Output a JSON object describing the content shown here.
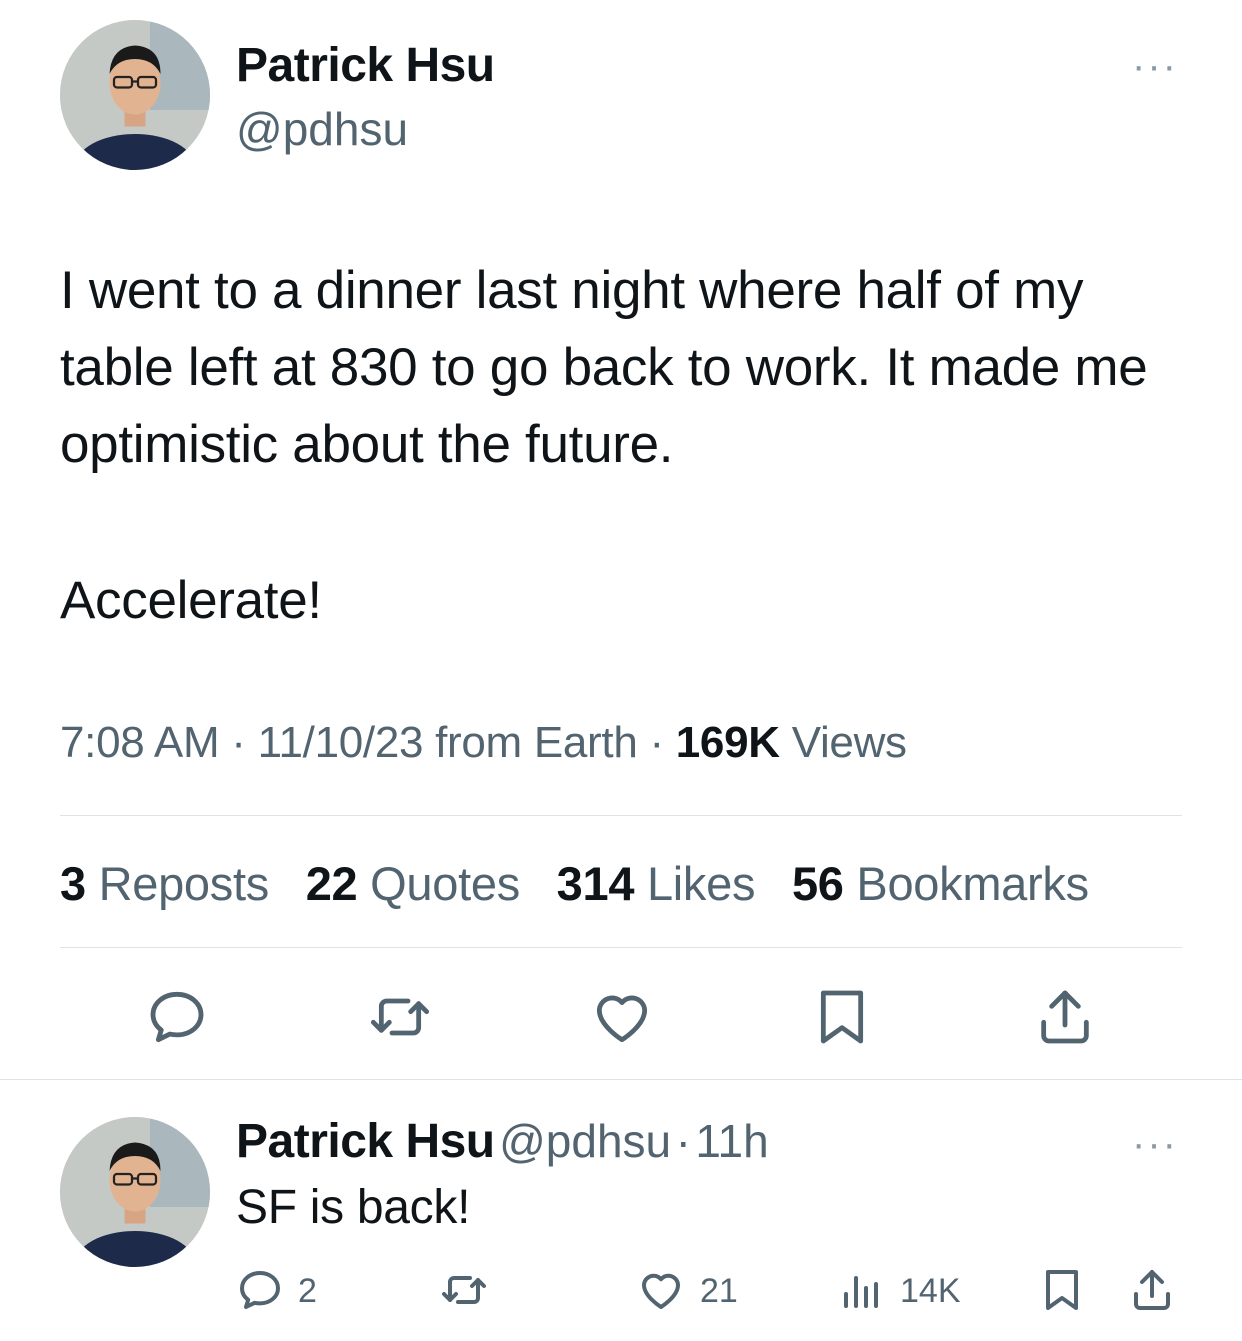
{
  "main_tweet": {
    "author_name": "Patrick Hsu",
    "author_handle": "@pdhsu",
    "more_label": "···",
    "text_paragraph_1": "I went to a dinner last night where half of my table left at 830 to go back to work. It made me optimistic about the future.",
    "text_paragraph_2": "Accelerate!",
    "time": "7:08 AM",
    "separator": "·",
    "date_source": "11/10/23 from Earth",
    "views_count": "169K",
    "views_label": "Views",
    "stats": {
      "reposts_count": "3",
      "reposts_label": "Reposts",
      "quotes_count": "22",
      "quotes_label": "Quotes",
      "likes_count": "314",
      "likes_label": "Likes",
      "bookmarks_count": "56",
      "bookmarks_label": "Bookmarks"
    },
    "actions": [
      "reply-icon",
      "repost-icon",
      "like-icon",
      "bookmark-icon",
      "share-icon"
    ]
  },
  "reply_tweet": {
    "author_name": "Patrick Hsu",
    "author_handle": "@pdhsu",
    "separator": "·",
    "time_ago": "11h",
    "more_label": "···",
    "text": "SF is back!",
    "reply_count": "2",
    "like_count": "21",
    "views_count": "14K"
  },
  "colors": {
    "text_primary": "#0f1419",
    "text_secondary": "#536471",
    "divider": "#dfe3e6"
  }
}
